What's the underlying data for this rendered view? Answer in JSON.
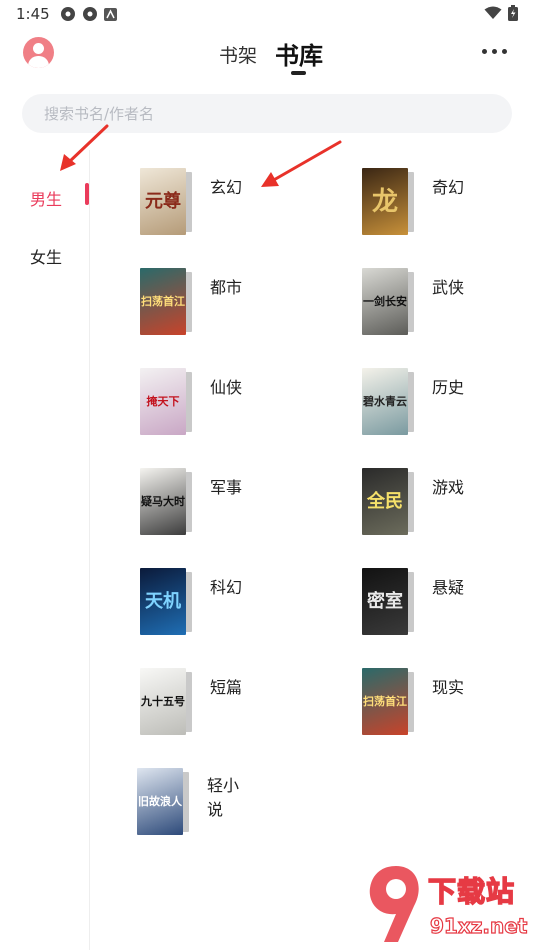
{
  "status_bar": {
    "time": "1:45"
  },
  "header": {
    "tabs": [
      {
        "label": "书架",
        "active": false
      },
      {
        "label": "书库",
        "active": true
      }
    ]
  },
  "search": {
    "placeholder": "搜索书名/作者名"
  },
  "sidebar": {
    "items": [
      {
        "label": "男生",
        "active": true
      },
      {
        "label": "女生",
        "active": false
      }
    ]
  },
  "genres": [
    {
      "label": "玄幻",
      "cover_text": "元尊",
      "cover_colors": [
        "#efe7d8",
        "#b59b78"
      ],
      "text_color": "#8a2a1a"
    },
    {
      "label": "奇幻",
      "cover_text": "龙",
      "cover_colors": [
        "#3a2614",
        "#c8913a"
      ],
      "text_color": "#e8c56a"
    },
    {
      "label": "都市",
      "cover_text": "扫荡首江",
      "cover_colors": [
        "#2a6a6a",
        "#c9432a"
      ],
      "text_color": "#ffde7a"
    },
    {
      "label": "武侠",
      "cover_text": "一剑长安",
      "cover_colors": [
        "#d9d9d4",
        "#5c5c58"
      ],
      "text_color": "#111111"
    },
    {
      "label": "仙侠",
      "cover_text": "掩天下",
      "cover_colors": [
        "#f3f1f2",
        "#c9a7c5"
      ],
      "text_color": "#c3121e"
    },
    {
      "label": "历史",
      "cover_text": "碧水青云",
      "cover_colors": [
        "#f4f2ea",
        "#7a9aa0"
      ],
      "text_color": "#222222"
    },
    {
      "label": "军事",
      "cover_text": "疑马大时",
      "cover_colors": [
        "#f5f4f0",
        "#3c3c3c"
      ],
      "text_color": "#111111"
    },
    {
      "label": "游戏",
      "cover_text": "全民",
      "cover_colors": [
        "#2a2a2a",
        "#6c6c5c"
      ],
      "text_color": "#f5e06a"
    },
    {
      "label": "科幻",
      "cover_text": "天机",
      "cover_colors": [
        "#0b1a3a",
        "#1f6eb4"
      ],
      "text_color": "#7fd3ff"
    },
    {
      "label": "悬疑",
      "cover_text": "密室",
      "cover_colors": [
        "#121212",
        "#3a3a3a"
      ],
      "text_color": "#e9e9e9"
    },
    {
      "label": "短篇",
      "cover_text": "九十五号",
      "cover_colors": [
        "#f8f8f6",
        "#bdbdb8"
      ],
      "text_color": "#111111"
    },
    {
      "label": "现实",
      "cover_text": "扫荡首江",
      "cover_colors": [
        "#2a6a6a",
        "#c9432a"
      ],
      "text_color": "#ffde7a"
    },
    {
      "label": "轻小说",
      "cover_text": "旧故浪人",
      "cover_colors": [
        "#dfe6f0",
        "#2d4a7a"
      ],
      "text_color": "#ffffff"
    }
  ],
  "watermark": {
    "title": "下载站",
    "url": "91xz.net"
  },
  "colors": {
    "accent": "#ea3b5b",
    "annotation_arrow": "#e8322a"
  }
}
